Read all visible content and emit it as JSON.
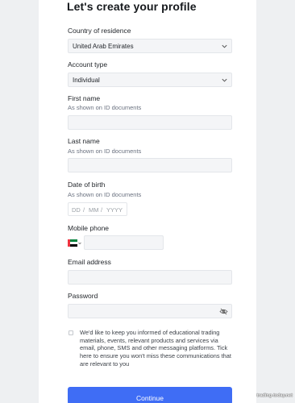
{
  "page": {
    "title": "Let's create your profile"
  },
  "country": {
    "label": "Country of residence",
    "value": "United Arab Emirates"
  },
  "account_type": {
    "label": "Account type",
    "value": "Individual"
  },
  "first_name": {
    "label": "First name",
    "hint": "As shown on ID documents",
    "value": ""
  },
  "last_name": {
    "label": "Last name",
    "hint": "As shown on ID documents",
    "value": ""
  },
  "dob": {
    "label": "Date of birth",
    "hint": "As shown on ID documents",
    "dd": "DD",
    "mm": "MM",
    "yyyy": "YYYY",
    "sep": "/"
  },
  "mobile": {
    "label": "Mobile phone",
    "flag_icon": "uae-flag-icon",
    "value": ""
  },
  "email": {
    "label": "Email address",
    "value": ""
  },
  "password": {
    "label": "Password",
    "value": "",
    "icon": "eye-off-icon"
  },
  "consent": {
    "text": "We'd like to keep you informed of educational trading materials, events, relevant products and services via email, phone, SMS and other messaging platforms. Tick here to ensure you won't miss these communications that are relevant to you",
    "checked": false
  },
  "actions": {
    "continue_label": "Continue"
  },
  "watermark": {
    "text": "trading-today.net"
  },
  "colors": {
    "accent": "#3f6df5",
    "panel": "#ffffff",
    "background": "#eef0f2",
    "field": "#f4f5f7"
  }
}
